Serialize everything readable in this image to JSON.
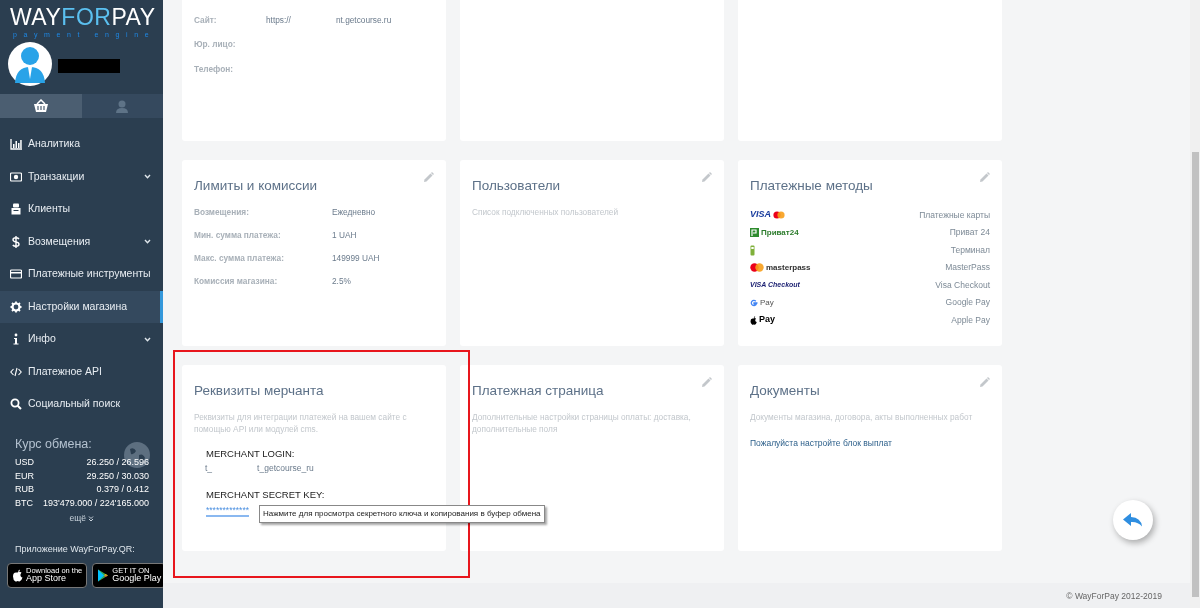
{
  "sidebar": {
    "logo": {
      "parts": [
        "WAY",
        "FOR",
        "PAY"
      ],
      "tagline": "payment engine"
    },
    "tabs": [
      {
        "selected": true
      },
      {
        "selected": false
      }
    ],
    "items": [
      {
        "label": "Аналитика",
        "expandable": false,
        "selected": false
      },
      {
        "label": "Транзакции",
        "expandable": true,
        "selected": false
      },
      {
        "label": "Клиенты",
        "expandable": false,
        "selected": false
      },
      {
        "label": "Возмещения",
        "expandable": true,
        "selected": false
      },
      {
        "label": "Платежные инструменты",
        "expandable": false,
        "selected": false
      },
      {
        "label": "Настройки магазина",
        "expandable": false,
        "selected": true
      },
      {
        "label": "Инфо",
        "expandable": true,
        "selected": false
      },
      {
        "label": "Платежное API",
        "expandable": false,
        "selected": false
      },
      {
        "label": "Социальный поиск",
        "expandable": false,
        "selected": false
      }
    ],
    "exchange": {
      "title": "Курс обмена:",
      "rates": [
        {
          "currency": "USD",
          "value": "26.250 / 26.596"
        },
        {
          "currency": "EUR",
          "value": "29.250 / 30.030"
        },
        {
          "currency": "RUB",
          "value": "0.379 / 0.412"
        },
        {
          "currency": "BTC",
          "value": "193'479.000 / 224'165.000"
        }
      ],
      "more": "ещё"
    },
    "app": {
      "title": "Приложение WayForPay.QR:",
      "stores": [
        {
          "kind": "apple",
          "small": "Download on the",
          "big": "App Store"
        },
        {
          "kind": "google",
          "small": "GET IT ON",
          "big": "Google Play"
        }
      ]
    }
  },
  "cards": [
    {
      "kind": "fields",
      "rows": [
        {
          "label": "Сайт:",
          "value": [
            "https://",
            "nt.getcourse.ru"
          ]
        },
        {
          "label": "Юр. лицо:",
          "value": []
        },
        {
          "label": "Телефон:",
          "value": []
        }
      ]
    },
    {
      "kind": "empty"
    },
    {
      "kind": "empty"
    },
    {
      "kind": "fields",
      "title": "Лимиты и комиссии",
      "editable": true,
      "rows": [
        {
          "label": "Возмещения:",
          "value": [
            "Ежедневно"
          ]
        },
        {
          "label": "Мин. сумма платежа:",
          "value": [
            "1 UAH"
          ]
        },
        {
          "label": "Макс. сумма платежа:",
          "value": [
            "149999 UAH"
          ]
        },
        {
          "label": "Комиссия магазина:",
          "value": [
            "2.5%"
          ]
        }
      ]
    },
    {
      "kind": "text",
      "title": "Пользователи",
      "editable": true,
      "description": "Список подключенных пользователей"
    },
    {
      "kind": "methods",
      "title": "Платежные методы",
      "editable": true,
      "methods": [
        {
          "logo_text": "VISA",
          "label": "Платежные карты"
        },
        {
          "logo_text": "Приват24",
          "label": "Приват 24"
        },
        {
          "label": "Терминал"
        },
        {
          "logo_text": "masterpass",
          "label": "MasterPass"
        },
        {
          "logo_text": "VISA Checkout",
          "label": "Visa Checkout"
        },
        {
          "logo_text": "Pay",
          "label": "Google Pay"
        },
        {
          "logo_text": "Pay",
          "label": "Apple Pay"
        }
      ]
    },
    {
      "kind": "merchant",
      "title": "Реквизиты мерчанта",
      "editable": false,
      "description": "Реквизиты для интеграции платежей на вашем сайте с помощью API или модулей cms.",
      "login_label": "MERCHANT LOGIN:",
      "login": [
        "t_",
        "t_getcourse_ru"
      ],
      "secret_label": "MERCHANT SECRET KEY:",
      "secret": "*************",
      "tooltip": "Нажмите для просмотра секретного ключа и копирования в буфер обмена"
    },
    {
      "kind": "text",
      "title": "Платежная страница",
      "editable": true,
      "description": "Дополнительные настройки страницы оплаты: доставка, дополнительные поля"
    },
    {
      "kind": "text",
      "title": "Документы",
      "editable": true,
      "description": "Документы магазина, договора, акты выполненных работ",
      "link": "Пожалуйста настройте блок выплат"
    }
  ],
  "footer": "© WayForPay 2012-2019"
}
